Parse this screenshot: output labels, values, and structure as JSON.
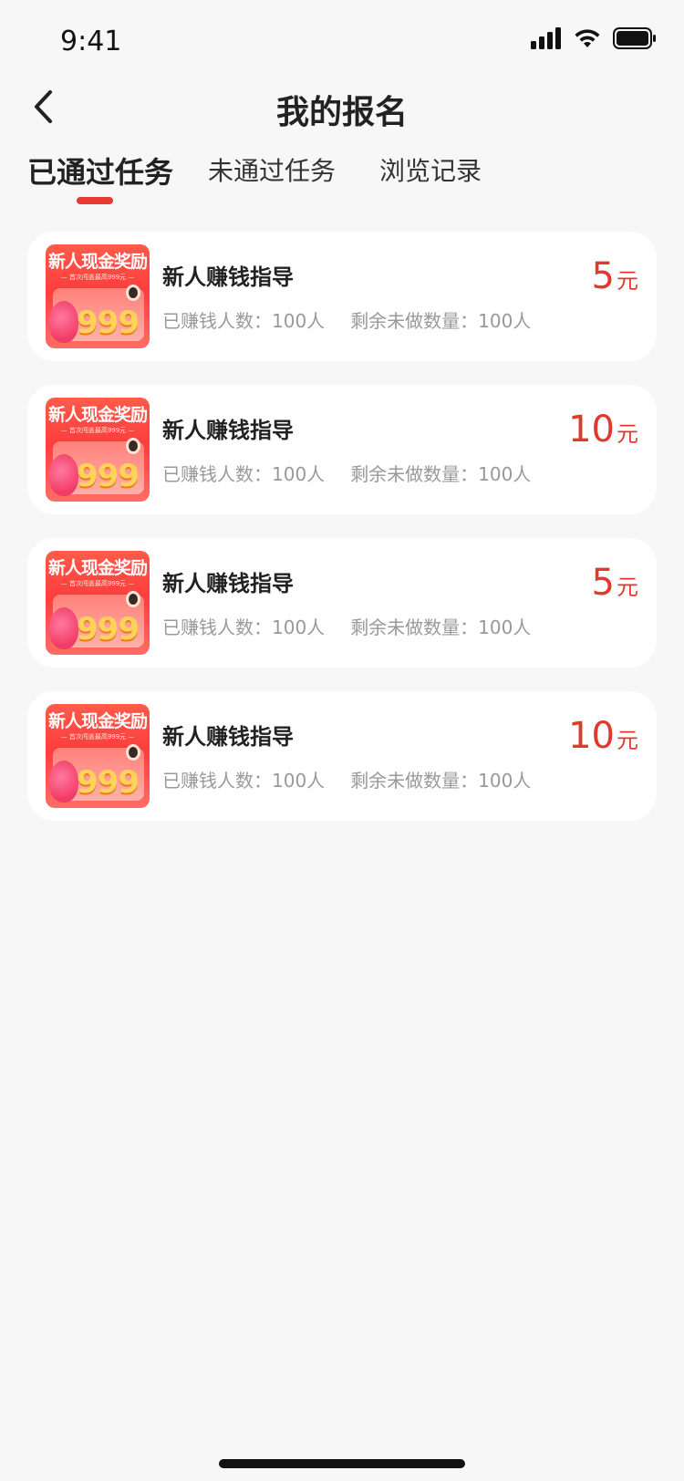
{
  "status": {
    "time": "9:41",
    "icons": [
      "cellular-signal-icon",
      "wifi-icon",
      "battery-icon"
    ]
  },
  "nav": {
    "title": "我的报名",
    "back_icon": "chevron-left-icon"
  },
  "tabs": [
    {
      "label": "已通过任务",
      "active": true
    },
    {
      "label": "未通过任务",
      "active": false
    },
    {
      "label": "浏览记录",
      "active": false
    }
  ],
  "thumb": {
    "title": "新人现金奖励",
    "subtitle": "— 首次闯盖最高999元 —",
    "number": "999"
  },
  "tasks": [
    {
      "title": "新人赚钱指导",
      "earned": "已赚钱人数：100人",
      "remaining": "剩余未做数量：100人",
      "price": "5",
      "unit": "元"
    },
    {
      "title": "新人赚钱指导",
      "earned": "已赚钱人数：100人",
      "remaining": "剩余未做数量：100人",
      "price": "10",
      "unit": "元"
    },
    {
      "title": "新人赚钱指导",
      "earned": "已赚钱人数：100人",
      "remaining": "剩余未做数量：100人",
      "price": "5",
      "unit": "元"
    },
    {
      "title": "新人赚钱指导",
      "earned": "已赚钱人数：100人",
      "remaining": "剩余未做数量：100人",
      "price": "10",
      "unit": "元"
    }
  ],
  "colors": {
    "accent": "#e63a32",
    "price": "#e03a2f",
    "background": "#f7f7f7",
    "card": "#ffffff"
  }
}
